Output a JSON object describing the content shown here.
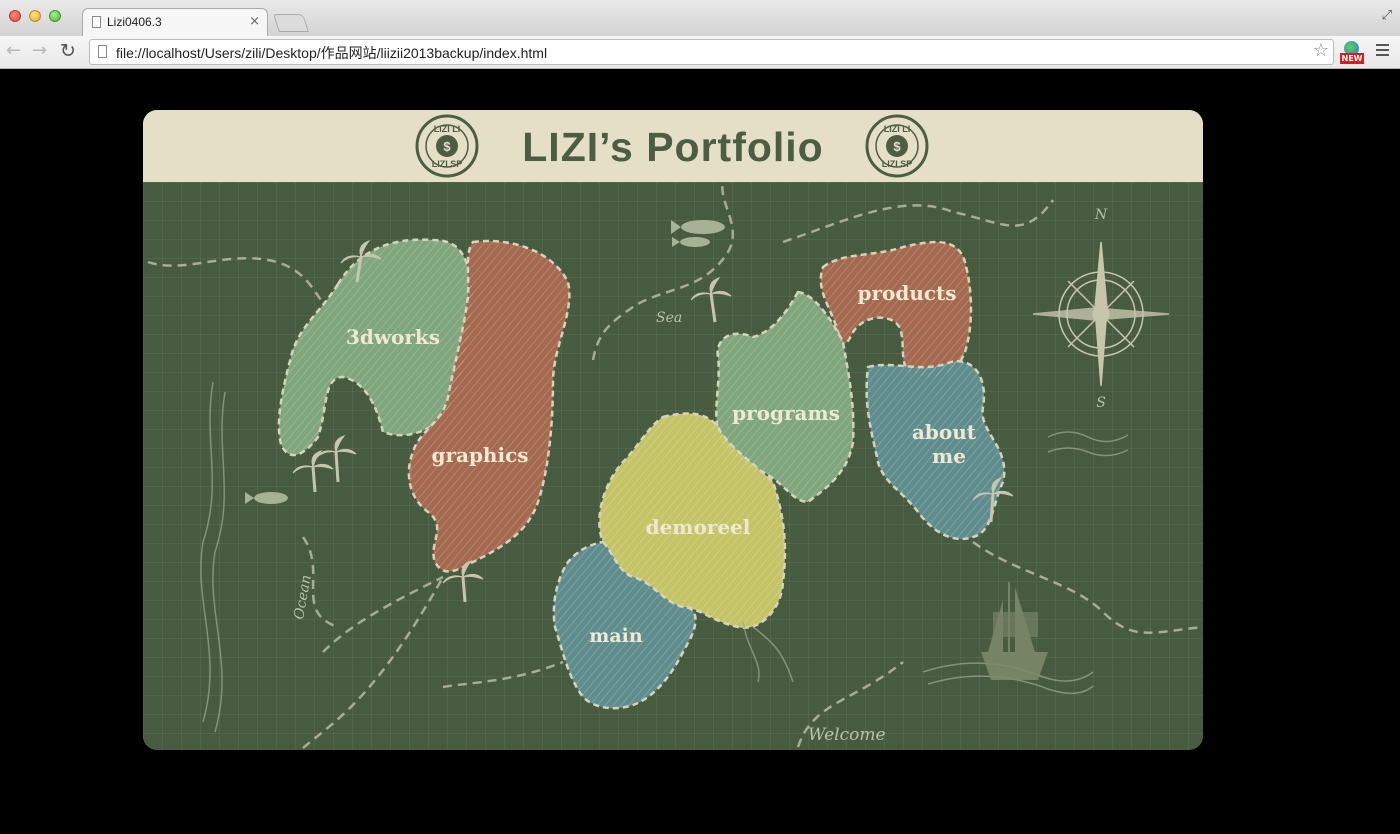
{
  "browser": {
    "tab_title": "Lizi0406.3",
    "tab_close": "×",
    "url": "file://localhost/Users/zili/Desktop/作品网站/liizii2013backup/index.html",
    "extension_badge": "NEW",
    "icons": {
      "back": "back-arrow-icon",
      "forward": "forward-arrow-icon",
      "reload": "reload-icon",
      "bookmark": "star-icon",
      "menu": "hamburger-menu-icon"
    }
  },
  "page": {
    "title": "LIZI’s Portfolio",
    "seal_text_top": "LIZI LI",
    "seal_text_bottom": "LIZI SP",
    "seal_center": "$",
    "map": {
      "regions": [
        {
          "key": "3dworks",
          "label": "3dworks",
          "color": "#7fa67d"
        },
        {
          "key": "graphics",
          "label": "graphics",
          "color": "#a4694f"
        },
        {
          "key": "products",
          "label": "products",
          "color": "#a4694f"
        },
        {
          "key": "programs",
          "label": "programs",
          "color": "#7fa67d"
        },
        {
          "key": "about",
          "label_line1": "about",
          "label_line2": "me",
          "color": "#5f8d8e"
        },
        {
          "key": "demoreel",
          "label": "demoreel",
          "color": "#c4c467"
        },
        {
          "key": "main",
          "label": "main",
          "color": "#5f8d8e"
        }
      ],
      "annotations": {
        "sea": "Sea",
        "ocean": "Ocean",
        "welcome": "Welcome",
        "compass_north": "N",
        "compass_south": "S"
      }
    },
    "colors": {
      "board": "#475b41",
      "header_paper": "#e4dfc6",
      "title_ink": "#4c5d44"
    }
  }
}
